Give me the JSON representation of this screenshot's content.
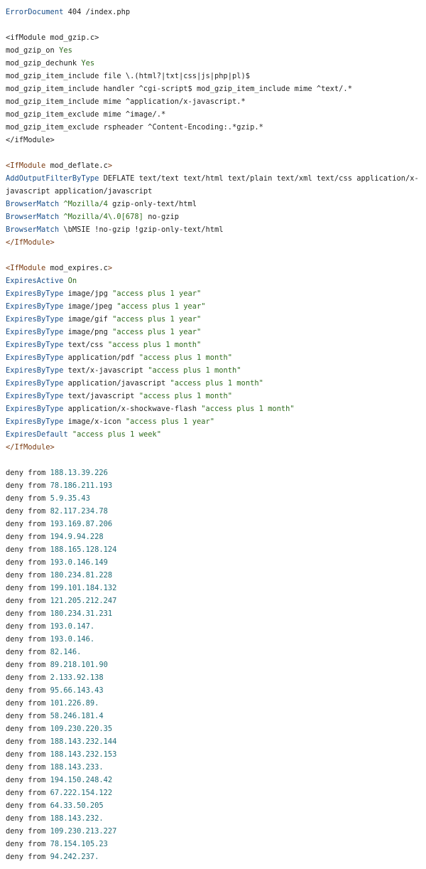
{
  "lines": [
    {
      "parts": [
        {
          "c": "k",
          "t": "ErrorDocument"
        },
        {
          "c": "n",
          "t": " 404 /index.php"
        }
      ]
    },
    {
      "parts": []
    },
    {
      "parts": [
        {
          "c": "n",
          "t": "<ifModule mod_gzip.c>"
        }
      ]
    },
    {
      "parts": [
        {
          "c": "n",
          "t": "mod_gzip_on "
        },
        {
          "c": "s",
          "t": "Yes"
        }
      ]
    },
    {
      "parts": [
        {
          "c": "n",
          "t": "mod_gzip_dechunk "
        },
        {
          "c": "s",
          "t": "Yes"
        }
      ]
    },
    {
      "parts": [
        {
          "c": "n",
          "t": "mod_gzip_item_include file \\.(html?|txt|css|js|php|pl)$"
        }
      ]
    },
    {
      "parts": [
        {
          "c": "n",
          "t": "mod_gzip_item_include handler ^cgi-script$ mod_gzip_item_include mime ^text/.*"
        }
      ]
    },
    {
      "parts": [
        {
          "c": "n",
          "t": "mod_gzip_item_include mime ^application/x-javascript.*"
        }
      ]
    },
    {
      "parts": [
        {
          "c": "n",
          "t": "mod_gzip_item_exclude mime ^image/.*"
        }
      ]
    },
    {
      "parts": [
        {
          "c": "n",
          "t": "mod_gzip_item_exclude rspheader ^Content-Encoding:.*gzip.*"
        }
      ]
    },
    {
      "parts": [
        {
          "c": "n",
          "t": "</ifModule>"
        }
      ]
    },
    {
      "parts": []
    },
    {
      "parts": [
        {
          "c": "t",
          "t": "<IfModule"
        },
        {
          "c": "n",
          "t": " mod_deflate.c"
        },
        {
          "c": "t",
          "t": ">"
        }
      ]
    },
    {
      "parts": [
        {
          "c": "k",
          "t": "AddOutputFilterByType"
        },
        {
          "c": "n",
          "t": " DEFLATE text/text text/html text/plain text/xml text/css application/x-"
        }
      ]
    },
    {
      "parts": [
        {
          "c": "n",
          "t": "javascript application/javascript"
        }
      ]
    },
    {
      "parts": [
        {
          "c": "k",
          "t": "BrowserMatch"
        },
        {
          "c": "s",
          "t": " ^Mozilla/4"
        },
        {
          "c": "n",
          "t": " gzip-only-text/html"
        }
      ]
    },
    {
      "parts": [
        {
          "c": "k",
          "t": "BrowserMatch"
        },
        {
          "c": "s",
          "t": " ^Mozilla/4\\.0[678]"
        },
        {
          "c": "n",
          "t": " no-gzip"
        }
      ]
    },
    {
      "parts": [
        {
          "c": "k",
          "t": "BrowserMatch"
        },
        {
          "c": "n",
          "t": " \\bMSIE !no-gzip !gzip-only-text/html"
        }
      ]
    },
    {
      "parts": [
        {
          "c": "t",
          "t": "</IfModule>"
        }
      ]
    },
    {
      "parts": []
    },
    {
      "parts": [
        {
          "c": "t",
          "t": "<IfModule"
        },
        {
          "c": "n",
          "t": " mod_expires.c"
        },
        {
          "c": "t",
          "t": ">"
        }
      ]
    },
    {
      "parts": [
        {
          "c": "k",
          "t": "ExpiresActive"
        },
        {
          "c": "s",
          "t": " On"
        }
      ]
    },
    {
      "parts": [
        {
          "c": "k",
          "t": "ExpiresByType"
        },
        {
          "c": "n",
          "t": " image/jpg "
        },
        {
          "c": "s",
          "t": "\"access plus 1 year\""
        }
      ]
    },
    {
      "parts": [
        {
          "c": "k",
          "t": "ExpiresByType"
        },
        {
          "c": "n",
          "t": " image/jpeg "
        },
        {
          "c": "s",
          "t": "\"access plus 1 year\""
        }
      ]
    },
    {
      "parts": [
        {
          "c": "k",
          "t": "ExpiresByType"
        },
        {
          "c": "n",
          "t": " image/gif "
        },
        {
          "c": "s",
          "t": "\"access plus 1 year\""
        }
      ]
    },
    {
      "parts": [
        {
          "c": "k",
          "t": "ExpiresByType"
        },
        {
          "c": "n",
          "t": " image/png "
        },
        {
          "c": "s",
          "t": "\"access plus 1 year\""
        }
      ]
    },
    {
      "parts": [
        {
          "c": "k",
          "t": "ExpiresByType"
        },
        {
          "c": "n",
          "t": " text/css "
        },
        {
          "c": "s",
          "t": "\"access plus 1 month\""
        }
      ]
    },
    {
      "parts": [
        {
          "c": "k",
          "t": "ExpiresByType"
        },
        {
          "c": "n",
          "t": " application/pdf "
        },
        {
          "c": "s",
          "t": "\"access plus 1 month\""
        }
      ]
    },
    {
      "parts": [
        {
          "c": "k",
          "t": "ExpiresByType"
        },
        {
          "c": "n",
          "t": " text/x-javascript "
        },
        {
          "c": "s",
          "t": "\"access plus 1 month\""
        }
      ]
    },
    {
      "parts": [
        {
          "c": "k",
          "t": "ExpiresByType"
        },
        {
          "c": "n",
          "t": " application/javascript "
        },
        {
          "c": "s",
          "t": "\"access plus 1 month\""
        }
      ]
    },
    {
      "parts": [
        {
          "c": "k",
          "t": "ExpiresByType"
        },
        {
          "c": "n",
          "t": " text/javascript "
        },
        {
          "c": "s",
          "t": "\"access plus 1 month\""
        }
      ]
    },
    {
      "parts": [
        {
          "c": "k",
          "t": "ExpiresByType"
        },
        {
          "c": "n",
          "t": " application/x-shockwave-flash "
        },
        {
          "c": "s",
          "t": "\"access plus 1 month\""
        }
      ]
    },
    {
      "parts": [
        {
          "c": "k",
          "t": "ExpiresByType"
        },
        {
          "c": "n",
          "t": " image/x-icon "
        },
        {
          "c": "s",
          "t": "\"access plus 1 year\""
        }
      ]
    },
    {
      "parts": [
        {
          "c": "k",
          "t": "ExpiresDefault"
        },
        {
          "c": "s",
          "t": " \"access plus 1 week\""
        }
      ]
    },
    {
      "parts": [
        {
          "c": "t",
          "t": "</IfModule>"
        }
      ]
    },
    {
      "parts": []
    },
    {
      "parts": [
        {
          "c": "n",
          "t": "deny from "
        },
        {
          "c": "ip",
          "t": "188.13.39.226"
        }
      ]
    },
    {
      "parts": [
        {
          "c": "n",
          "t": "deny from "
        },
        {
          "c": "ip",
          "t": "78.186.211.193"
        }
      ]
    },
    {
      "parts": [
        {
          "c": "n",
          "t": "deny from "
        },
        {
          "c": "ip",
          "t": "5.9.35.43"
        }
      ]
    },
    {
      "parts": [
        {
          "c": "n",
          "t": "deny from "
        },
        {
          "c": "ip",
          "t": "82.117.234.78"
        }
      ]
    },
    {
      "parts": [
        {
          "c": "n",
          "t": "deny from "
        },
        {
          "c": "ip",
          "t": "193.169.87.206"
        }
      ]
    },
    {
      "parts": [
        {
          "c": "n",
          "t": "deny from "
        },
        {
          "c": "ip",
          "t": "194.9.94.228"
        }
      ]
    },
    {
      "parts": [
        {
          "c": "n",
          "t": "deny from "
        },
        {
          "c": "ip",
          "t": "188.165.128.124"
        }
      ]
    },
    {
      "parts": [
        {
          "c": "n",
          "t": "deny from "
        },
        {
          "c": "ip",
          "t": "193.0.146.149"
        }
      ]
    },
    {
      "parts": [
        {
          "c": "n",
          "t": "deny from "
        },
        {
          "c": "ip",
          "t": "180.234.81.228"
        }
      ]
    },
    {
      "parts": [
        {
          "c": "n",
          "t": "deny from "
        },
        {
          "c": "ip",
          "t": "199.101.184.132"
        }
      ]
    },
    {
      "parts": [
        {
          "c": "n",
          "t": "deny from "
        },
        {
          "c": "ip",
          "t": "121.205.212.247"
        }
      ]
    },
    {
      "parts": [
        {
          "c": "n",
          "t": "deny from "
        },
        {
          "c": "ip",
          "t": "180.234.31.231"
        }
      ]
    },
    {
      "parts": [
        {
          "c": "n",
          "t": "deny from "
        },
        {
          "c": "ip",
          "t": "193.0.147."
        }
      ]
    },
    {
      "parts": [
        {
          "c": "n",
          "t": "deny from "
        },
        {
          "c": "ip",
          "t": "193.0.146."
        }
      ]
    },
    {
      "parts": [
        {
          "c": "n",
          "t": "deny from "
        },
        {
          "c": "ip",
          "t": "82.146."
        }
      ]
    },
    {
      "parts": [
        {
          "c": "n",
          "t": "deny from "
        },
        {
          "c": "ip",
          "t": "89.218.101.90"
        }
      ]
    },
    {
      "parts": [
        {
          "c": "n",
          "t": "deny from "
        },
        {
          "c": "ip",
          "t": "2.133.92.138"
        }
      ]
    },
    {
      "parts": [
        {
          "c": "n",
          "t": "deny from "
        },
        {
          "c": "ip",
          "t": "95.66.143.43"
        }
      ]
    },
    {
      "parts": [
        {
          "c": "n",
          "t": "deny from "
        },
        {
          "c": "ip",
          "t": "101.226.89."
        }
      ]
    },
    {
      "parts": [
        {
          "c": "n",
          "t": "deny from "
        },
        {
          "c": "ip",
          "t": "58.246.181.4"
        }
      ]
    },
    {
      "parts": [
        {
          "c": "n",
          "t": "deny from "
        },
        {
          "c": "ip",
          "t": "109.230.220.35"
        }
      ]
    },
    {
      "parts": [
        {
          "c": "n",
          "t": "deny from "
        },
        {
          "c": "ip",
          "t": "188.143.232.144"
        }
      ]
    },
    {
      "parts": [
        {
          "c": "n",
          "t": "deny from "
        },
        {
          "c": "ip",
          "t": "188.143.232.153"
        }
      ]
    },
    {
      "parts": [
        {
          "c": "n",
          "t": "deny from "
        },
        {
          "c": "ip",
          "t": "188.143.233."
        }
      ]
    },
    {
      "parts": [
        {
          "c": "n",
          "t": "deny from "
        },
        {
          "c": "ip",
          "t": "194.150.248.42"
        }
      ]
    },
    {
      "parts": [
        {
          "c": "n",
          "t": "deny from "
        },
        {
          "c": "ip",
          "t": "67.222.154.122"
        }
      ]
    },
    {
      "parts": [
        {
          "c": "n",
          "t": "deny from "
        },
        {
          "c": "ip",
          "t": "64.33.50.205"
        }
      ]
    },
    {
      "parts": [
        {
          "c": "n",
          "t": "deny from "
        },
        {
          "c": "ip",
          "t": "188.143.232."
        }
      ]
    },
    {
      "parts": [
        {
          "c": "n",
          "t": "deny from "
        },
        {
          "c": "ip",
          "t": "109.230.213.227"
        }
      ]
    },
    {
      "parts": [
        {
          "c": "n",
          "t": "deny from "
        },
        {
          "c": "ip",
          "t": "78.154.105.23"
        }
      ]
    },
    {
      "parts": [
        {
          "c": "n",
          "t": "deny from "
        },
        {
          "c": "ip",
          "t": "94.242.237."
        }
      ]
    }
  ]
}
